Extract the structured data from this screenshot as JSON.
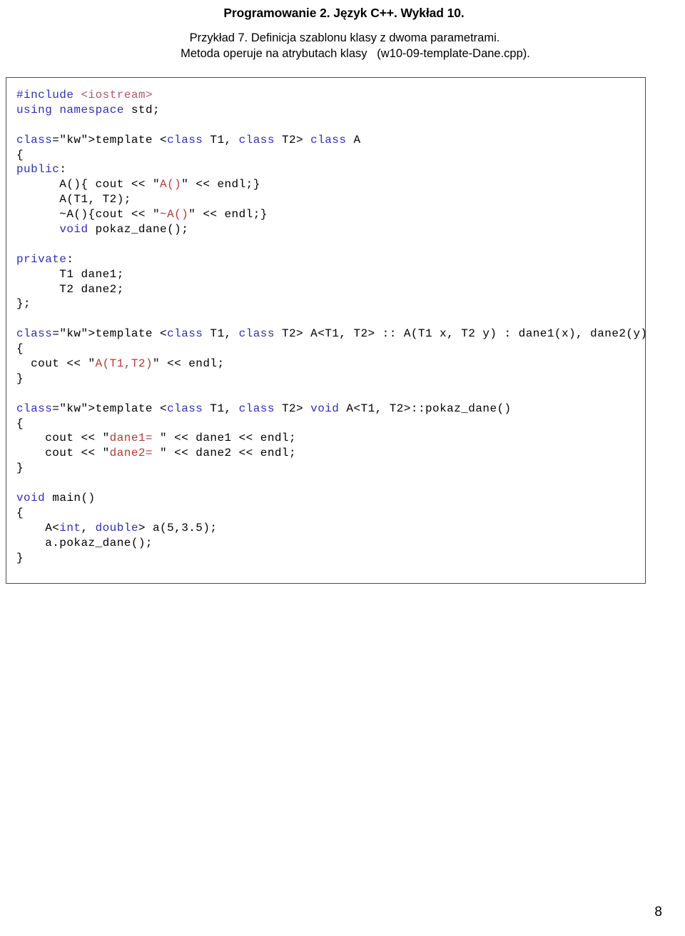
{
  "header": {
    "title": "Programowanie 2. Język C++. Wykład 10.",
    "subtitle_line_1": "Przykład 7. Definicja szablonu klasy z dwoma parametrami.",
    "subtitle_line_2": "Metoda operuje na atrybutach klasy   (w10-09-template-Dane.cpp)."
  },
  "code": {
    "language": "cpp",
    "lines": [
      "#include <iostream>",
      "using namespace std;",
      "",
      "template <class T1, class T2> class A",
      "{",
      "public:",
      "      A(){ cout << \"A()\" << endl;}",
      "      A(T1, T2);",
      "      ~A(){cout << \"~A()\" << endl;}",
      "      void pokaz_dane();",
      "",
      "private:",
      "      T1 dane1;",
      "      T2 dane2;",
      "};",
      "",
      "template <class T1, class T2> A<T1, T2> :: A(T1 x, T2 y) : dane1(x), dane2(y)",
      "{",
      "  cout << \"A(T1,T2)\" << endl;",
      "}",
      "",
      "template <class T1, class T2> void A<T1, T2>::pokaz_dane()",
      "{",
      "    cout << \"dane1= \" << dane1 << endl;",
      "    cout << \"dane2= \" << dane2 << endl;",
      "}",
      "",
      "void main()",
      "{",
      "    A<int, double> a(5,3.5);",
      "    a.pokaz_dane();",
      "}"
    ],
    "colors": {
      "keyword": "#2f2fb3",
      "include_target": "#b05a6a",
      "string": "#b03a3a",
      "plain": "#000000",
      "border": "#4d4d4d"
    }
  },
  "footer": {
    "page_number": "8"
  }
}
